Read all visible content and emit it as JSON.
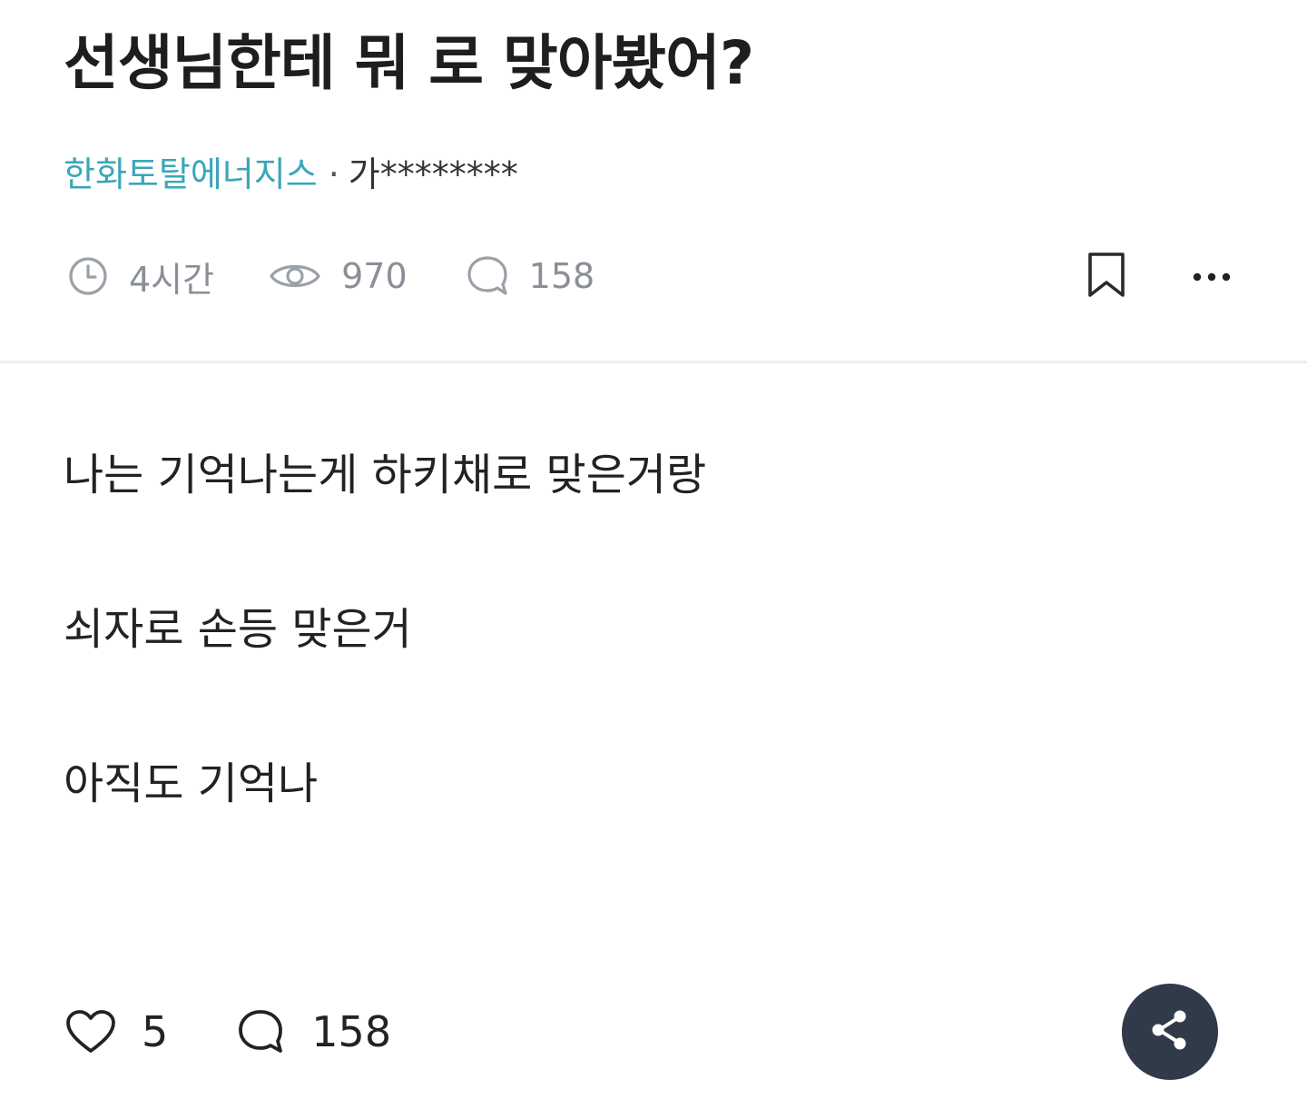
{
  "post": {
    "title": "선생님한테 뭐 로 맞아봤어?",
    "company": "한화토탈에너지스",
    "separator": "·",
    "author": "가********",
    "time_ago": "4시간",
    "views": "970",
    "comments": "158",
    "paragraphs": [
      "나는 기억나는게 하키채로 맞은거랑",
      "쇠자로 손등 맞은거",
      "아직도 기억나"
    ]
  },
  "actions": {
    "likes": "5",
    "comments": "158"
  },
  "icons": {
    "time": "clock-icon",
    "views": "eye-icon",
    "comments": "comment-icon",
    "bookmark": "bookmark-icon",
    "more": "more-horizontal-icon",
    "like": "heart-icon",
    "share": "share-icon"
  },
  "colors": {
    "company_link": "#3aa6b9",
    "meta_text": "#8a8f97",
    "share_button_bg": "#313a48",
    "divider": "#eeeeee"
  }
}
